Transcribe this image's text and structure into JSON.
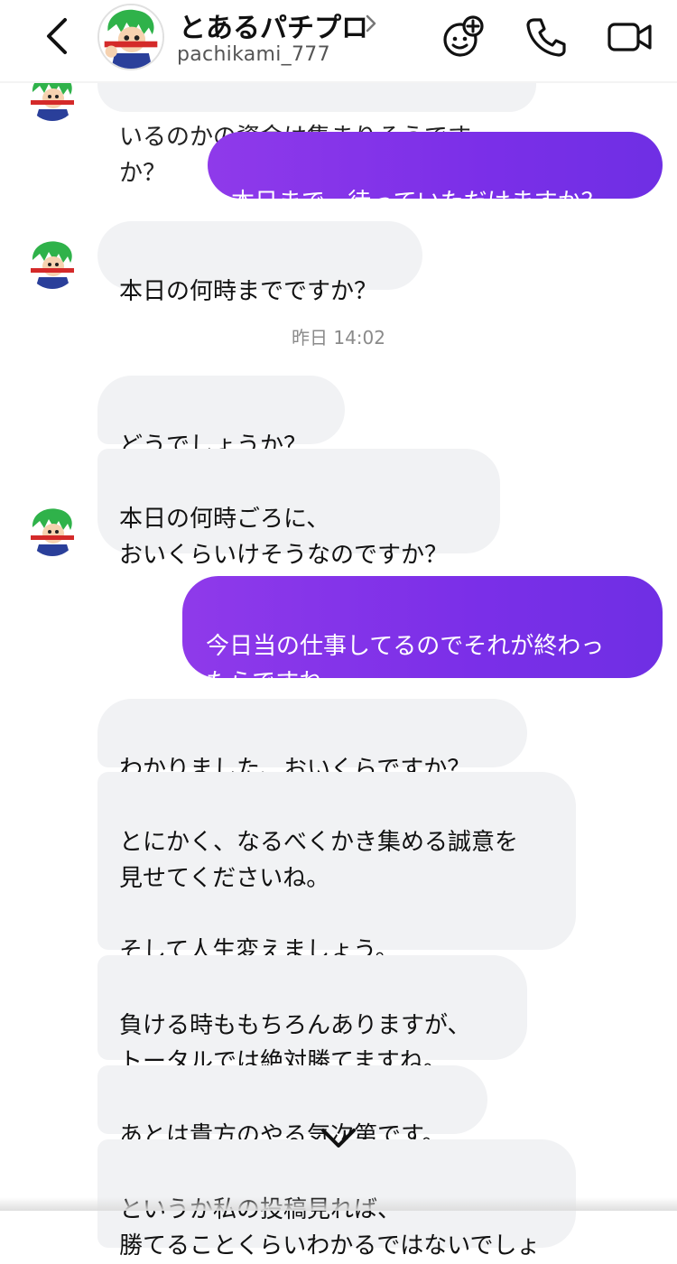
{
  "header": {
    "contact_name": "とあるパチプロ",
    "username": "pachikami_777",
    "icons": [
      "back-chevron",
      "avatar",
      "games-icon",
      "phone-icon",
      "video-icon"
    ]
  },
  "top_partial_text": "いるのかの資金は集まりそうですか？",
  "messages": [
    {
      "from": "me",
      "text": "本日まで，待っていただけますか？"
    },
    {
      "from": "them",
      "text": "本日の何時までですか？"
    },
    {
      "from": "them",
      "text": "どうでしょうか？"
    },
    {
      "from": "them",
      "text": "本日の何時ごろに、\nおいくらいけそうなのですか？"
    },
    {
      "from": "me",
      "text": "今日当の仕事してるのでそれが終わっ\nたらですね"
    },
    {
      "from": "them",
      "text": "わかりました、おいくらですか？"
    },
    {
      "from": "them",
      "text": "とにかく、なるべくかき集める誠意を\n見せてくださいね。\n\nそして人生変えましょう。"
    },
    {
      "from": "them",
      "text": "負ける時ももちろんありますが、\nトータルでは絶対勝てますね。"
    },
    {
      "from": "them",
      "text": "あとは貴方のやる気次第です。"
    },
    {
      "from": "them",
      "text": "というか私の投稿見れば、\n勝てることくらいわかるではないでしょ"
    }
  ],
  "timestamp": "昨日 14:02",
  "colors": {
    "outgoing_start": "#8f3aea",
    "outgoing_end": "#6f2fe4",
    "incoming_bg": "#f1f2f4"
  }
}
